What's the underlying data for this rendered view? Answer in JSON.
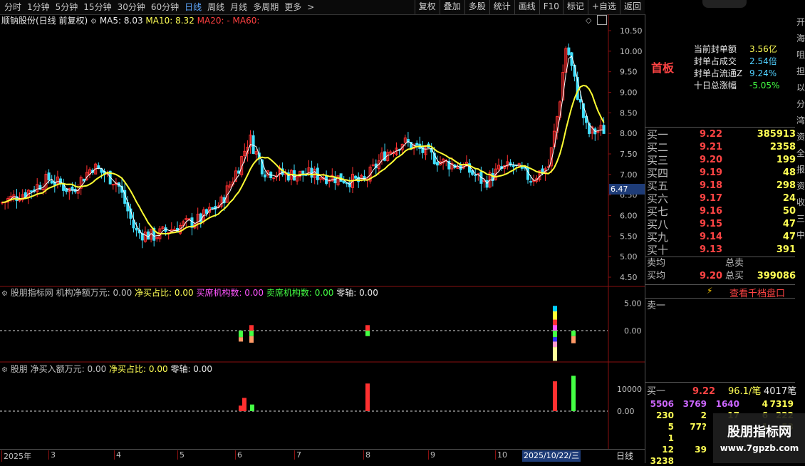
{
  "toolbar": {
    "periods": [
      "分时",
      "1分钟",
      "5分钟",
      "15分钟",
      "30分钟",
      "60分钟",
      "日线",
      "周线",
      "月线",
      "多周期",
      "更多"
    ],
    "active_period": "日线",
    "more_arrow": ">",
    "actions": [
      "复权",
      "叠加",
      "多股",
      "统计",
      "画线",
      "F10",
      "标记",
      "+自选",
      "返回"
    ]
  },
  "main_chart": {
    "stock_label": "顺钠股份(日线 前复权)",
    "ma5": "MA5: 8.03",
    "ma10": "MA10: 8.32",
    "ma20": "MA20: -",
    "ma60": "MA60: ",
    "current_price_tag": "6.47",
    "y_ticks": [
      "10.50",
      "10.00",
      "9.50",
      "9.00",
      "8.50",
      "8.00",
      "7.50",
      "7.00",
      "6.50",
      "6.00",
      "5.50",
      "5.00",
      "4.50"
    ],
    "colors": {
      "up": "#ff3030",
      "down": "#40e0ff",
      "ma5": "#ffffff",
      "ma10": "#ffff33"
    }
  },
  "indicator1": {
    "title": "股朋指标网",
    "fields": [
      {
        "label": "机构净额万元: 0.00",
        "color": "#c0c0c0"
      },
      {
        "label": "净买占比: 0.00",
        "color": "#ffff55"
      },
      {
        "label": "买席机构数: 0.00",
        "color": "#ff55ff"
      },
      {
        "label": "卖席机构数: 0.00",
        "color": "#44ff44"
      },
      {
        "label": "零轴: 0.00",
        "color": "#e8e8e8"
      }
    ],
    "y_ticks": [
      "5.00",
      "0.00",
      "-5.00"
    ]
  },
  "indicator2": {
    "title": "股朋",
    "fields": [
      {
        "label": "净买入额万元: 0.00",
        "color": "#c0c0c0"
      },
      {
        "label": "净买占比: 0.00",
        "color": "#ffff55"
      },
      {
        "label": "零轴: 0.00",
        "color": "#e8e8e8"
      }
    ],
    "y_ticks": [
      "10000",
      "0.00"
    ]
  },
  "x_axis": {
    "labels": [
      "2025年",
      "3",
      "4",
      "5",
      "6",
      "7",
      "8",
      "9",
      "10"
    ],
    "cursor_date": "2025/10/22/三",
    "period_label": "日线"
  },
  "right_panel": {
    "board_label": "首板",
    "stats": [
      {
        "label": "当前封单额",
        "value": "3.56亿"
      },
      {
        "label": "封单占成交",
        "value": "2.54倍"
      },
      {
        "label": "封单占流通Z",
        "value": "9.24%"
      },
      {
        "label": "十日总涨幅",
        "value": "-5.05%"
      }
    ],
    "bids": [
      {
        "label": "买一",
        "price": "9.22",
        "vol": "385913"
      },
      {
        "label": "买二",
        "price": "9.21",
        "vol": "2358"
      },
      {
        "label": "买三",
        "price": "9.20",
        "vol": "199"
      },
      {
        "label": "买四",
        "price": "9.19",
        "vol": "48"
      },
      {
        "label": "买五",
        "price": "9.18",
        "vol": "298"
      },
      {
        "label": "买六",
        "price": "9.17",
        "vol": "24"
      },
      {
        "label": "买七",
        "price": "9.16",
        "vol": "50"
      },
      {
        "label": "买八",
        "price": "9.15",
        "vol": "47"
      },
      {
        "label": "买九",
        "price": "9.14",
        "vol": "47"
      },
      {
        "label": "买十",
        "price": "9.13",
        "vol": "391"
      }
    ],
    "sell_avg_label": "卖均",
    "sell_total_label": "总卖",
    "buy_avg_label": "买均",
    "buy_avg_price": "9.20",
    "buy_total_label": "总买",
    "buy_total_vol": "399086",
    "view_depth_label": "查看千档盘口",
    "sell1_label": "卖一",
    "buy1_row": {
      "label": "买一",
      "price": "9.22",
      "ratio": "96.1/笔",
      "count": "4017笔"
    },
    "queue_rows": [
      [
        "5506",
        "3769",
        "1640",
        "4",
        "7319"
      ],
      [
        "230",
        "2",
        "17",
        "6",
        "222"
      ],
      [
        "5",
        "77?",
        "",
        "1",
        "53"
      ],
      [
        "1",
        "",
        "",
        "",
        ""
      ],
      [
        "12",
        "39",
        "",
        "",
        ""
      ],
      [
        "3238",
        "",
        "",
        "",
        ""
      ]
    ],
    "edge_chars": [
      "开",
      "海",
      "咀",
      "担",
      "以",
      "分",
      "湾",
      "资",
      "全",
      "报",
      "资",
      "收",
      "三",
      "中"
    ],
    "watermark_title": "股朋指标网",
    "watermark_url": "www.7gpzb.com"
  }
}
